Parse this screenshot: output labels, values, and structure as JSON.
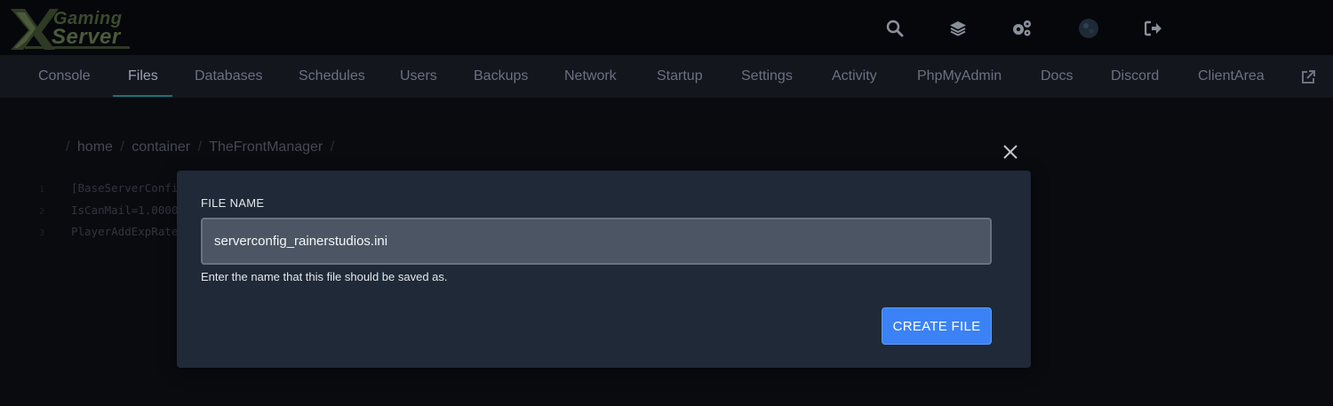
{
  "logo": {
    "line1": "Gaming",
    "line2": "Server",
    "mark": "X",
    "colors": {
      "primary": "#4b5a3a",
      "secondary": "#3a4a2c"
    }
  },
  "top_icons": [
    {
      "name": "search-icon"
    },
    {
      "name": "layers-icon"
    },
    {
      "name": "cogs-icon"
    },
    {
      "name": "avatar"
    },
    {
      "name": "logout-icon"
    }
  ],
  "nav": {
    "items": [
      {
        "label": "Console",
        "active": false
      },
      {
        "label": "Files",
        "active": true
      },
      {
        "label": "Databases",
        "active": false
      },
      {
        "label": "Schedules",
        "active": false
      },
      {
        "label": "Users",
        "active": false
      },
      {
        "label": "Backups",
        "active": false
      },
      {
        "label": "Network",
        "active": false
      },
      {
        "label": "Startup",
        "active": false
      },
      {
        "label": "Settings",
        "active": false
      },
      {
        "label": "Activity",
        "active": false
      },
      {
        "label": "PhpMyAdmin",
        "active": false
      },
      {
        "label": "Docs",
        "active": false
      },
      {
        "label": "Discord",
        "active": false
      },
      {
        "label": "ClientArea",
        "active": false
      }
    ],
    "external_icon": "external-link-icon",
    "accent": "#1f6f78"
  },
  "breadcrumb": {
    "segments": [
      "home",
      "container",
      "TheFrontManager"
    ]
  },
  "editor": {
    "lines": [
      {
        "num": "1",
        "text": "[BaseServerConfi"
      },
      {
        "num": "2",
        "text": "IsCanMail=1.0000"
      },
      {
        "num": "3",
        "text": "PlayerAddExpRate"
      }
    ]
  },
  "modal": {
    "field_label": "FILE NAME",
    "input_value": "serverconfig_rainerstudios.ini",
    "help_text": "Enter the name that this file should be saved as.",
    "create_button": "CREATE FILE",
    "close_icon": "close-icon",
    "colors": {
      "background": "#1f2937",
      "button": "#3b82f6",
      "input": "#4b5563"
    }
  }
}
